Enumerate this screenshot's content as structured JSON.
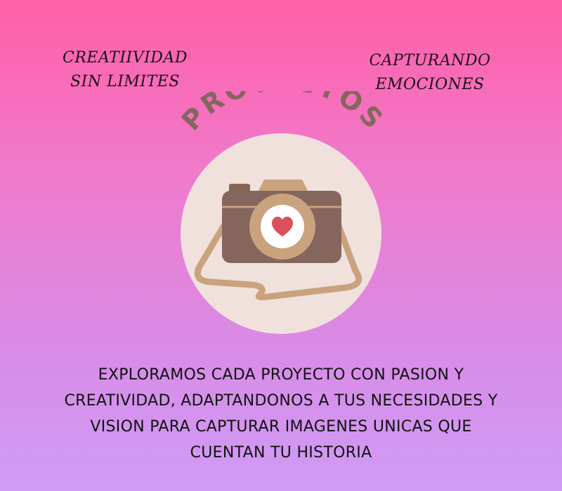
{
  "taglines": {
    "left": [
      "CREATIIVIDAD",
      "SIN LIMITES"
    ],
    "right": [
      "CAPTURANDO",
      "EMOCIONES"
    ]
  },
  "logo": {
    "arc_title": "PROYECTOS",
    "icon": "camera-heart-icon",
    "colors": {
      "circle": "#f0e1dc",
      "camera_body": "#85665c",
      "camera_accent": "#c9a27e",
      "lens_inner": "#ffffff",
      "heart": "#d9505a",
      "title": "#85665c"
    }
  },
  "description": [
    "EXPLORAMOS CADA PROYECTO CON PASION Y",
    "CREATIVIDAD, ADAPTANDONOS A TUS NECESIDADES Y",
    "VISION PARA CAPTURAR IMAGENES UNICAS QUE",
    "CUENTAN TU HISTORIA"
  ],
  "background": {
    "top": "#ff5fa8",
    "bottom": "#cf9cf6"
  }
}
